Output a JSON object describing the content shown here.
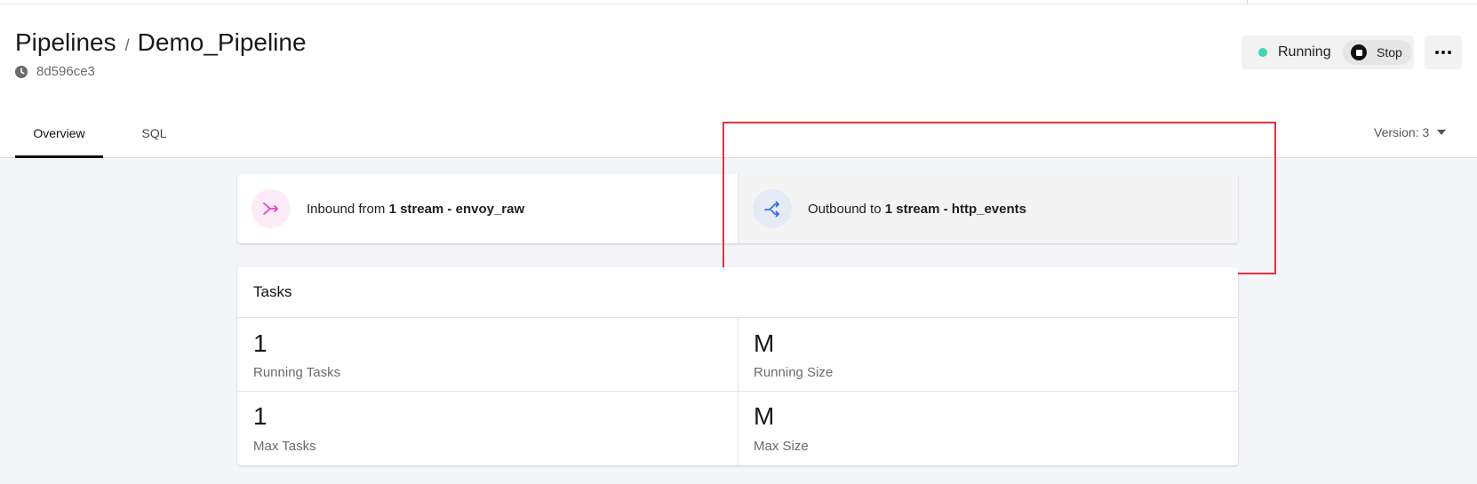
{
  "breadcrumb": {
    "root": "Pipelines",
    "separator": "/",
    "current": "Demo_Pipeline"
  },
  "pipeline_hash": "8d596ce3",
  "status": {
    "label": "Running",
    "color": "#3fd8b4",
    "stop_label": "Stop"
  },
  "tabs": [
    {
      "label": "Overview",
      "active": true
    },
    {
      "label": "SQL",
      "active": false
    }
  ],
  "version": {
    "label": "Version: 3"
  },
  "streams": {
    "inbound": {
      "prefix": "Inbound from",
      "detail": "1 stream - envoy_raw",
      "icon": "merge-arrow-icon",
      "color": "#e040c8"
    },
    "outbound": {
      "prefix": "Outbound to",
      "detail": "1 stream - http_events",
      "icon": "shuffle-arrow-icon",
      "color": "#2f6fe0"
    }
  },
  "highlight_color": "#e5323e",
  "tasks": {
    "title": "Tasks",
    "metrics": [
      {
        "value": "1",
        "label": "Running Tasks"
      },
      {
        "value": "M",
        "label": "Running Size"
      },
      {
        "value": "1",
        "label": "Max Tasks"
      },
      {
        "value": "M",
        "label": "Max Size"
      }
    ]
  }
}
